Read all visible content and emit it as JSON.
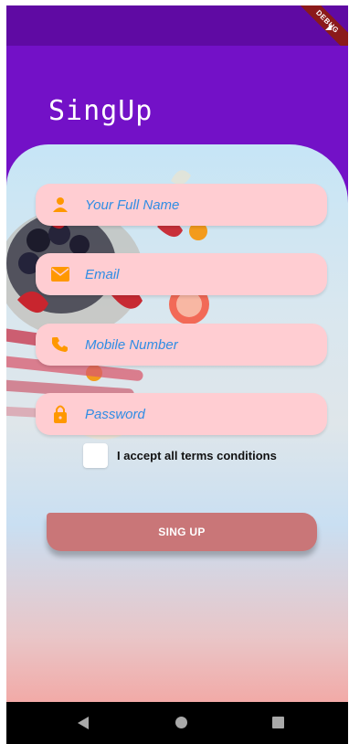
{
  "status_bar": {
    "debug_label": "DEBUG"
  },
  "page": {
    "title": "SingUp"
  },
  "form": {
    "fields": [
      {
        "icon": "person-icon",
        "placeholder": "Your Full Name",
        "value": ""
      },
      {
        "icon": "email-icon",
        "placeholder": "Email",
        "value": ""
      },
      {
        "icon": "phone-icon",
        "placeholder": "Mobile Number",
        "value": ""
      },
      {
        "icon": "lock-icon",
        "placeholder": "Password",
        "value": ""
      }
    ],
    "terms_label": "I accept all terms conditions",
    "terms_checked": false,
    "submit_label": "SING UP"
  },
  "colors": {
    "primary": "#7311c7",
    "field_bg": "#ffcdd2",
    "icon": "#ff9800",
    "placeholder": "#2f8de4",
    "button": "#c97678"
  },
  "nav_bar": {
    "back": "back-icon",
    "home": "home-icon",
    "recent": "recent-apps-icon"
  }
}
